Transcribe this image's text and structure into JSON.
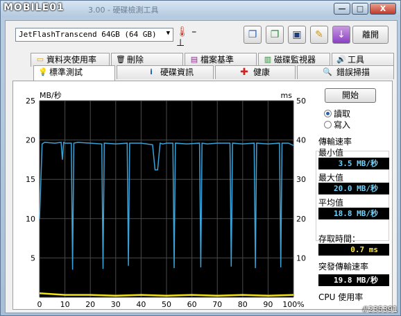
{
  "window": {
    "logo": "MOBILE01",
    "title": "3.00 - 硬碟檢測工具",
    "minimize": "—",
    "maximize": "□",
    "close": "X"
  },
  "toolbar": {
    "drive": "JetFlashTranscend 64GB (64 GB)",
    "temperature": "– ⊥",
    "exit_label": "離開",
    "buttons": [
      "copy-icon",
      "copy-alt-icon",
      "save-icon",
      "options-icon",
      "download-icon"
    ]
  },
  "tabs_top": [
    {
      "label": "資料夾使用率",
      "icon": "folder-icon"
    },
    {
      "label": "刪除",
      "icon": "trash-icon"
    },
    {
      "label": "檔案基準",
      "icon": "file-bench-icon"
    },
    {
      "label": "磁碟監視器",
      "icon": "monitor-chart-icon"
    },
    {
      "label": "工具",
      "icon": "speaker-icon"
    }
  ],
  "tabs_bottom": [
    {
      "label": "標準測試",
      "icon": "bulb-icon",
      "active": true
    },
    {
      "label": "硬碟資訊",
      "icon": "info-icon"
    },
    {
      "label": "健康",
      "icon": "health-cross-icon"
    },
    {
      "label": "錯誤掃描",
      "icon": "magnifier-icon"
    }
  ],
  "controls": {
    "start_label": "開始",
    "read_label": "讀取",
    "write_label": "寫入",
    "read_selected": true
  },
  "stats": {
    "transfer_title": "傳輸速率",
    "min_label": "最小值",
    "min_value": "3.5 MB/秒",
    "max_label": "最大值",
    "max_value": "20.0 MB/秒",
    "avg_label": "平均值",
    "avg_value": "18.8 MB/秒",
    "access_label": "存取時間：",
    "access_value": "0.7 ms",
    "burst_label": "突發傳輸速率",
    "burst_value": "19.8 MB/秒",
    "cpu_label": "CPU 使用率"
  },
  "chart_data": {
    "type": "line",
    "left_axis_label": "MB/秒",
    "right_axis_label": "ms",
    "left_ylim": [
      0,
      25
    ],
    "right_ylim": [
      0,
      50
    ],
    "left_ticks": [
      "25",
      "20",
      "15",
      "10",
      "5"
    ],
    "right_ticks": [
      "50",
      "40",
      "30",
      "20",
      "10"
    ],
    "x_ticks": [
      "0",
      "10",
      "20",
      "30",
      "40",
      "50",
      "60",
      "70",
      "80",
      "90",
      "100%"
    ],
    "grid": true,
    "background_color": "#000000",
    "grid_color": "#4a4a4a",
    "series": [
      {
        "color": "#3aa3d9",
        "baseline": 19.6,
        "x": [
          0,
          1,
          2,
          6,
          8.5,
          9,
          9.5,
          10,
          11,
          12.5,
          13,
          13.5,
          15,
          20,
          24.5,
          25,
          25.5,
          30,
          34.5,
          35,
          35.5,
          40,
          44.5,
          45.5,
          46.5,
          47.5,
          48.5,
          50,
          52.5,
          53,
          53.5,
          58,
          63,
          63.5,
          64,
          66,
          70,
          75,
          75.5,
          76,
          80,
          84.5,
          85,
          85.5,
          90,
          94.5,
          95,
          95.5,
          98,
          100
        ],
        "y": [
          10,
          19.5,
          19.7,
          19.6,
          19.7,
          17.5,
          19.7,
          19.6,
          19.6,
          19.6,
          3.5,
          19.6,
          19.7,
          19.6,
          19.5,
          3.6,
          19.6,
          19.5,
          19.6,
          4.0,
          19.6,
          19.6,
          19.4,
          16.2,
          16.2,
          19.6,
          19.5,
          19.6,
          19.6,
          3.7,
          19.6,
          19.5,
          19.6,
          3.8,
          19.6,
          19.5,
          19.6,
          19.6,
          3.9,
          19.6,
          19.5,
          19.6,
          3.7,
          19.6,
          19.5,
          19.6,
          3.8,
          19.6,
          19.6,
          19.3
        ]
      },
      {
        "color": "#f2e21c",
        "x": [
          0,
          10,
          20,
          30,
          40,
          50,
          60,
          70,
          80,
          90,
          100
        ],
        "y": [
          0.5,
          0.3,
          0.3,
          0.2,
          0.3,
          0.2,
          0.3,
          0.2,
          0.3,
          0.2,
          0.3
        ]
      }
    ]
  },
  "watermark": "#235391"
}
